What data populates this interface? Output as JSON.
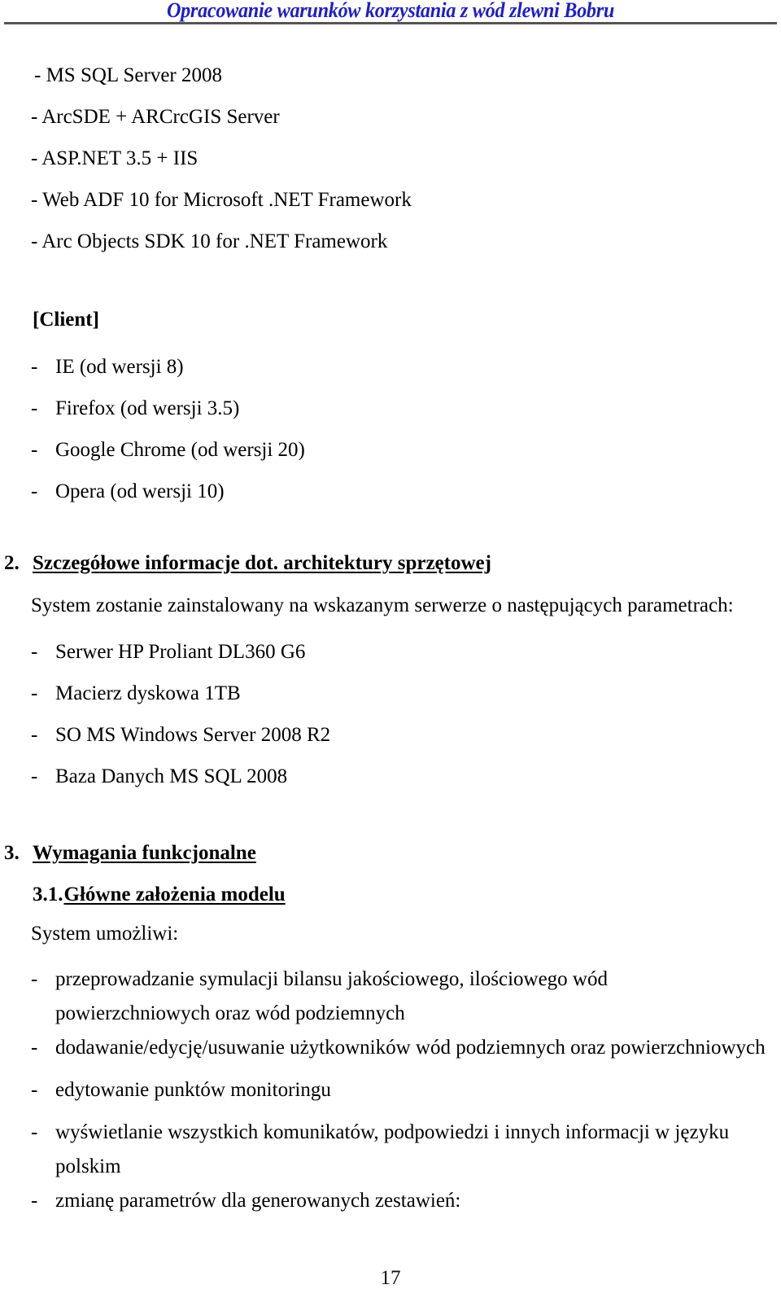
{
  "header": {
    "title": "Opracowanie warunków korzystania z wód zlewni Bobru",
    "rule_color": "#555555",
    "title_color": "#1e1ec8"
  },
  "software_list": [
    {
      "text": "- MS SQL Server 2008"
    },
    {
      "text": "- ArcSDE + ARCrcGIS Server"
    },
    {
      "text": "- ASP.NET 3.5 + IIS"
    },
    {
      "text": "- Web ADF 10 for Microsoft .NET Framework"
    },
    {
      "text": "- Arc Objects SDK 10 for .NET Framework"
    }
  ],
  "client_block": {
    "label": "[Client]",
    "items": [
      {
        "dash": "-",
        "text": "IE (od wersji 8)"
      },
      {
        "dash": "-",
        "text": "Firefox (od wersji 3.5)"
      },
      {
        "dash": "-",
        "text": "Google Chrome (od wersji 20)"
      },
      {
        "dash": "-",
        "text": "Opera (od wersji 10)"
      }
    ]
  },
  "section2": {
    "number": "2.",
    "title": "Szczegółowe informacje dot. architektury sprzętowej",
    "intro": "System zostanie zainstalowany na wskazanym serwerze o następujących parametrach:",
    "items": [
      {
        "dash": "-",
        "text": "Serwer HP Proliant DL360 G6"
      },
      {
        "dash": "-",
        "text": "Macierz dyskowa 1TB"
      },
      {
        "dash": "-",
        "text": "SO MS Windows Server 2008 R2"
      },
      {
        "dash": "-",
        "text": "Baza Danych MS SQL 2008"
      }
    ]
  },
  "section3": {
    "number": "3.",
    "title": "Wymagania funkcjonalne",
    "subsection": {
      "number": "3.1.",
      "title": "Główne założenia modelu",
      "intro": "System umożliwi:",
      "items": [
        {
          "dash": "-",
          "text": "przeprowadzanie symulacji bilansu jakościowego, ilościowego wód powierzchniowych oraz wód podziemnych"
        },
        {
          "dash": "-",
          "text": "dodawanie/edycję/usuwanie użytkowników wód podziemnych oraz powierzchniowych"
        },
        {
          "dash": "-",
          "text": "edytowanie punktów monitoringu"
        },
        {
          "dash": "-",
          "text": "wyświetlanie  wszystkich komunikatów, podpowiedzi i innych informacji w języku polskim"
        },
        {
          "dash": "-",
          "text": "zmianę parametrów dla generowanych zestawień:"
        }
      ]
    }
  },
  "footer": {
    "page_number": "17"
  }
}
